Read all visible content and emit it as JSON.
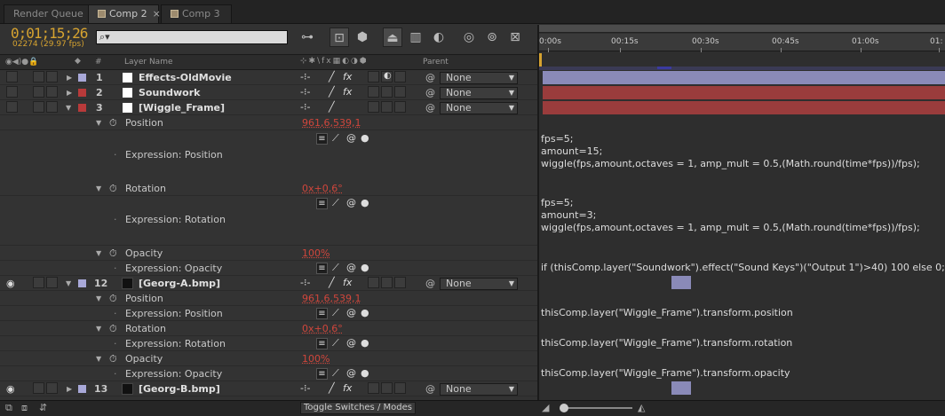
{
  "tabs": [
    {
      "label": "Render Queue"
    },
    {
      "label": "Comp 2"
    },
    {
      "label": "Comp 3"
    }
  ],
  "timecode": "0;01;15;26",
  "frames": "02274 (29.97 fps)",
  "search": {
    "placeholder": "⌕▾"
  },
  "header": {
    "layer_name": "Layer Name",
    "num": "#",
    "parent": "Parent"
  },
  "ruler": [
    "0:00s",
    "00:15s",
    "00:30s",
    "00:45s",
    "01:00s",
    "01:"
  ],
  "layers": [
    {
      "num": "1",
      "name": "Effects-OldMovie",
      "parent": "None",
      "label_color": "#a8a8d8"
    },
    {
      "num": "2",
      "name": "Soundwork",
      "parent": "None",
      "label_color": "#b83a3a"
    },
    {
      "num": "3",
      "name": "[Wiggle_Frame]",
      "parent": "None",
      "label_color": "#b83a3a"
    },
    {
      "num": "12",
      "name": "[Georg-A.bmp]",
      "parent": "None",
      "label_color": "#a8a8d8"
    },
    {
      "num": "13",
      "name": "[Georg-B.bmp]",
      "parent": "None",
      "label_color": "#a8a8d8"
    }
  ],
  "props": {
    "position": "Position",
    "position_val": "961,6,539,1",
    "expr_position": "Expression: Position",
    "rotation": "Rotation",
    "rotation_val": "0x+0,6°",
    "expr_rotation": "Expression: Rotation",
    "opacity": "Opacity",
    "opacity_val": "100%",
    "expr_opacity": "Expression: Opacity"
  },
  "expressions": {
    "pos3": "fps=5;\namount=15;\nwiggle(fps,amount,octaves = 1, amp_mult = 0.5,(Math.round(time*fps))/fps);",
    "rot3": "fps=5;\namount=3;\nwiggle(fps,amount,octaves = 1, amp_mult = 0.5,(Math.round(time*fps))/fps);",
    "op3": "if (thisComp.layer(\"Soundwork\").effect(\"Sound Keys\")(\"Output 1\")>40) 100 else 0;",
    "pos12": "thisComp.layer(\"Wiggle_Frame\").transform.position",
    "rot12": "thisComp.layer(\"Wiggle_Frame\").transform.rotation",
    "op12": "thisComp.layer(\"Wiggle_Frame\").transform.opacity"
  },
  "footer": {
    "toggle": "Toggle Switches / Modes"
  },
  "colors": {
    "timecode": "#d6a330",
    "value": "#d0463c",
    "bar_blue": "#8a8ab8",
    "bar_red": "#9a3c3c"
  }
}
